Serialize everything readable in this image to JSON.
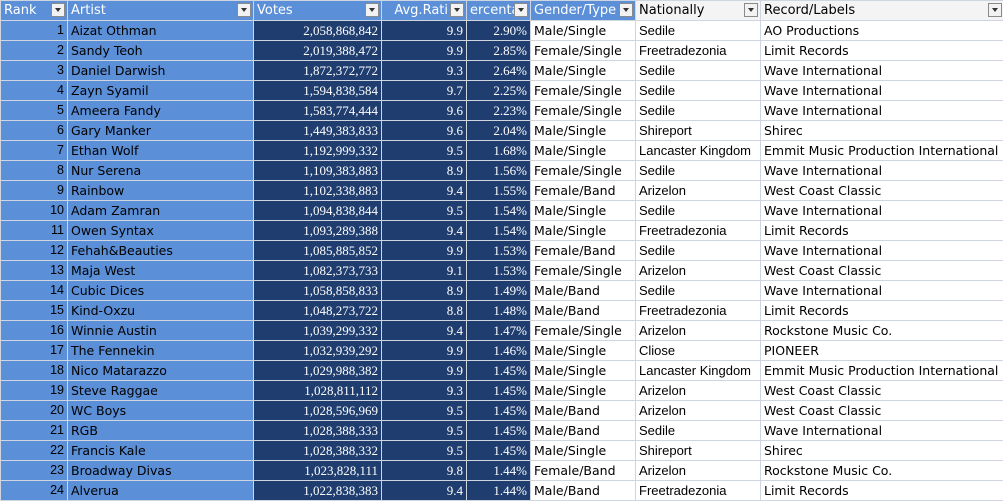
{
  "headers": {
    "rank": "Rank",
    "artist": "Artist",
    "votes": "Votes",
    "avg": "Avg.Rati",
    "pct": "ercenta",
    "gender": "Gender/Type",
    "nation": "Nationally",
    "label": "Record/Labels"
  },
  "rows": [
    {
      "rank": "1",
      "artist": "Aizat Othman",
      "votes": "2,058,868,842",
      "avg": "9.9",
      "pct": "2.90%",
      "gender": "Male/Single",
      "nation": "Sedile",
      "label": "AO Productions"
    },
    {
      "rank": "2",
      "artist": "Sandy Teoh",
      "votes": "2,019,388,472",
      "avg": "9.9",
      "pct": "2.85%",
      "gender": "Female/Single",
      "nation": "Freetradezonia",
      "label": "Limit Records"
    },
    {
      "rank": "3",
      "artist": "Daniel Darwish",
      "votes": "1,872,372,772",
      "avg": "9.3",
      "pct": "2.64%",
      "gender": "Male/Single",
      "nation": "Sedile",
      "label": "Wave International"
    },
    {
      "rank": "4",
      "artist": "Zayn Syamil",
      "votes": "1,594,838,584",
      "avg": "9.7",
      "pct": "2.25%",
      "gender": "Female/Single",
      "nation": "Sedile",
      "label": "Wave International"
    },
    {
      "rank": "5",
      "artist": "Ameera Fandy",
      "votes": "1,583,774,444",
      "avg": "9.6",
      "pct": "2.23%",
      "gender": "Female/Single",
      "nation": "Sedile",
      "label": "Wave International"
    },
    {
      "rank": "6",
      "artist": "Gary Manker",
      "votes": "1,449,383,833",
      "avg": "9.6",
      "pct": "2.04%",
      "gender": "Male/Single",
      "nation": "Shireport",
      "label": "Shirec"
    },
    {
      "rank": "7",
      "artist": "Ethan Wolf",
      "votes": "1,192,999,332",
      "avg": "9.5",
      "pct": "1.68%",
      "gender": "Male/Single",
      "nation": "Lancaster Kingdom",
      "label": "Emmit Music Production International"
    },
    {
      "rank": "8",
      "artist": "Nur Serena",
      "votes": "1,109,383,883",
      "avg": "8.9",
      "pct": "1.56%",
      "gender": "Female/Single",
      "nation": "Sedile",
      "label": "Wave International"
    },
    {
      "rank": "9",
      "artist": "Rainbow",
      "votes": "1,102,338,883",
      "avg": "9.4",
      "pct": "1.55%",
      "gender": "Female/Band",
      "nation": "Arizelon",
      "label": "West Coast Classic"
    },
    {
      "rank": "10",
      "artist": "Adam Zamran",
      "votes": "1,094,838,844",
      "avg": "9.5",
      "pct": "1.54%",
      "gender": "Male/Single",
      "nation": "Sedile",
      "label": "Wave International"
    },
    {
      "rank": "11",
      "artist": "Owen Syntax",
      "votes": "1,093,289,388",
      "avg": "9.4",
      "pct": "1.54%",
      "gender": "Male/Single",
      "nation": "Freetradezonia",
      "label": "Limit Records"
    },
    {
      "rank": "12",
      "artist": "Fehah&Beauties",
      "votes": "1,085,885,852",
      "avg": "9.9",
      "pct": "1.53%",
      "gender": "Female/Band",
      "nation": "Sedile",
      "label": "Wave International"
    },
    {
      "rank": "13",
      "artist": "Maja West",
      "votes": "1,082,373,733",
      "avg": "9.1",
      "pct": "1.53%",
      "gender": "Female/Single",
      "nation": "Arizelon",
      "label": "West Coast Classic"
    },
    {
      "rank": "14",
      "artist": "Cubic Dices",
      "votes": "1,058,858,833",
      "avg": "8.9",
      "pct": "1.49%",
      "gender": "Male/Band",
      "nation": "Sedile",
      "label": "Wave International"
    },
    {
      "rank": "15",
      "artist": "Kind-Oxzu",
      "votes": "1,048,273,722",
      "avg": "8.8",
      "pct": "1.48%",
      "gender": "Male/Band",
      "nation": "Freetradezonia",
      "label": "Limit Records"
    },
    {
      "rank": "16",
      "artist": "Winnie Austin",
      "votes": "1,039,299,332",
      "avg": "9.4",
      "pct": "1.47%",
      "gender": "Female/Single",
      "nation": "Arizelon",
      "label": "Rockstone Music Co."
    },
    {
      "rank": "17",
      "artist": "The Fennekin",
      "votes": "1,032,939,292",
      "avg": "9.9",
      "pct": "1.46%",
      "gender": "Male/Single",
      "nation": "Cliose",
      "label": "PIONEER"
    },
    {
      "rank": "18",
      "artist": "Nico Matarazzo",
      "votes": "1,029,988,382",
      "avg": "9.9",
      "pct": "1.45%",
      "gender": "Male/Single",
      "nation": "Lancaster Kingdom",
      "label": "Emmit Music Production International"
    },
    {
      "rank": "19",
      "artist": "Steve Raggae",
      "votes": "1,028,811,112",
      "avg": "9.3",
      "pct": "1.45%",
      "gender": "Male/Single",
      "nation": "Arizelon",
      "label": "West Coast Classic"
    },
    {
      "rank": "20",
      "artist": "WC Boys",
      "votes": "1,028,596,969",
      "avg": "9.5",
      "pct": "1.45%",
      "gender": "Male/Band",
      "nation": "Arizelon",
      "label": "West Coast Classic"
    },
    {
      "rank": "21",
      "artist": "RGB",
      "votes": "1,028,388,333",
      "avg": "9.5",
      "pct": "1.45%",
      "gender": "Male/Band",
      "nation": "Sedile",
      "label": "Wave International"
    },
    {
      "rank": "22",
      "artist": "Francis Kale",
      "votes": "1,028,388,332",
      "avg": "9.5",
      "pct": "1.45%",
      "gender": "Male/Single",
      "nation": "Shireport",
      "label": "Shirec"
    },
    {
      "rank": "23",
      "artist": "Broadway Divas",
      "votes": "1,023,828,111",
      "avg": "9.8",
      "pct": "1.44%",
      "gender": "Female/Band",
      "nation": "Arizelon",
      "label": "Rockstone Music Co."
    },
    {
      "rank": "24",
      "artist": "Alverua",
      "votes": "1,022,838,383",
      "avg": "9.4",
      "pct": "1.44%",
      "gender": "Male/Band",
      "nation": "Freetradezonia",
      "label": "Limit Records"
    }
  ]
}
